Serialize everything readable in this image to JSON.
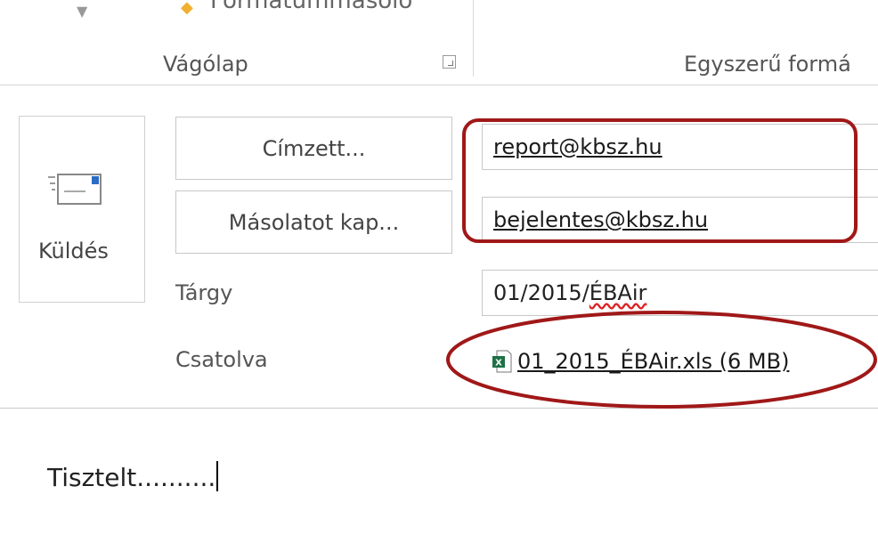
{
  "ribbon": {
    "cut_off_label": "Formátummásoló",
    "groups": [
      {
        "label": "Vágólap"
      },
      {
        "label": "Egyszerű formá"
      }
    ]
  },
  "send": {
    "label": "Küldés",
    "icon": "send-envelope-icon"
  },
  "to": {
    "button_label": "Címzett...",
    "value": "report@kbsz.hu"
  },
  "cc": {
    "button_label": "Másolatot kap...",
    "value": "bejelentes@kbsz.hu"
  },
  "subject": {
    "label": "Tárgy",
    "value_prefix": "01/2015/",
    "value_misspelled": "ÉBAir"
  },
  "attachment": {
    "label": "Csatolva",
    "file": "01_2015_ÉBAir.xls (6 MB)",
    "icon": "excel-file-icon"
  },
  "body": {
    "text": "Tisztelt.........."
  },
  "annotation_color": "#a01818"
}
